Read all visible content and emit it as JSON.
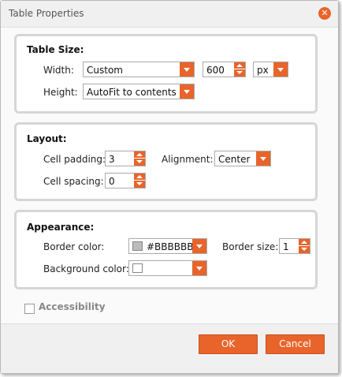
{
  "dialog": {
    "title": "Table Properties"
  },
  "table_size": {
    "title": "Table Size:",
    "width_label": "Width:",
    "width_mode": "Custom",
    "width_value": "600",
    "width_unit": "px",
    "height_label": "Height:",
    "height_mode": "AutoFit to contents"
  },
  "layout": {
    "title": "Layout:",
    "cell_padding_label": "Cell padding:",
    "cell_padding_value": "3",
    "alignment_label": "Alignment:",
    "alignment_value": "Center",
    "cell_spacing_label": "Cell spacing:",
    "cell_spacing_value": "0"
  },
  "appearance": {
    "title": "Appearance:",
    "border_color_label": "Border color:",
    "border_color_value": "#BBBBBB",
    "border_color_swatch": "#bbbbbb",
    "border_size_label": "Border size:",
    "border_size_value": "1",
    "background_color_label": "Background color:",
    "background_color_value": ""
  },
  "accessibility": {
    "label": "Accessibility",
    "checked": false
  },
  "footer": {
    "ok_label": "OK",
    "cancel_label": "Cancel"
  },
  "colors": {
    "accent": "#e8642a"
  }
}
